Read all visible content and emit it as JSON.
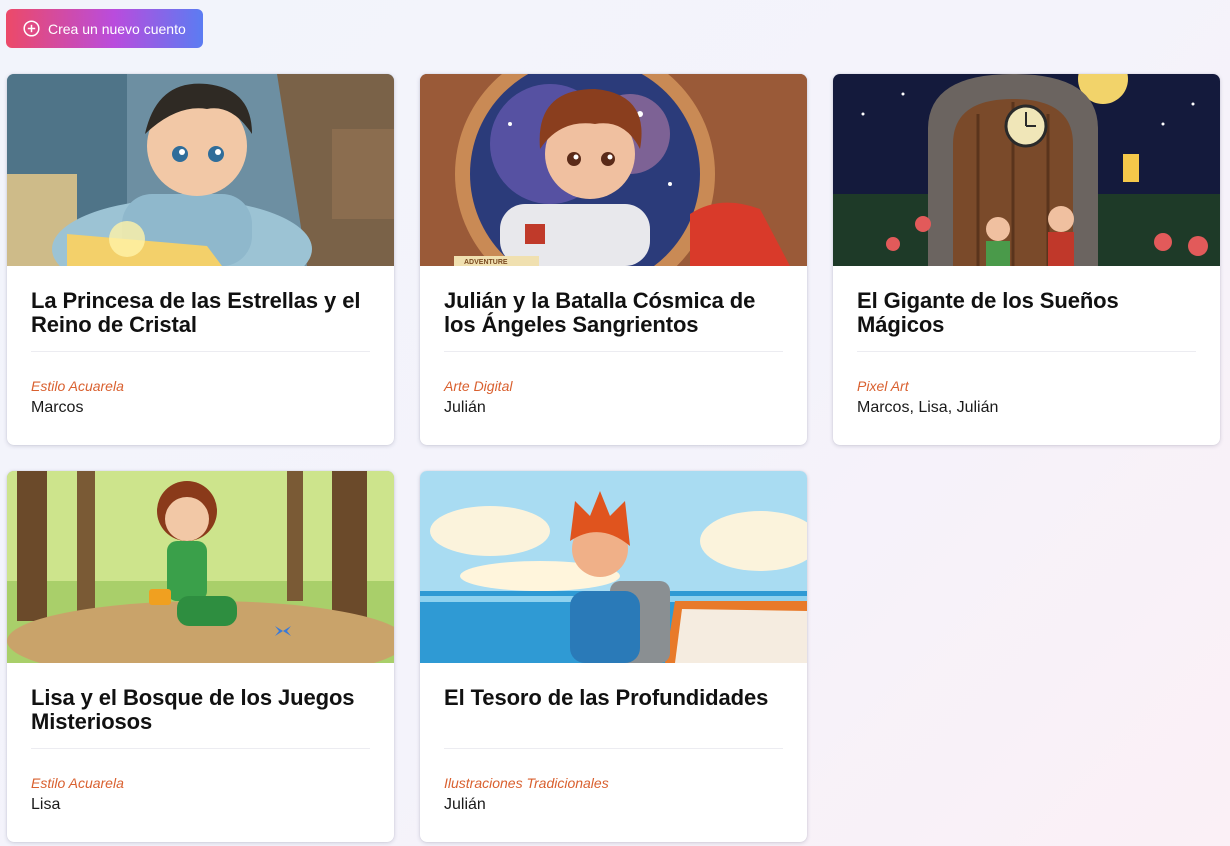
{
  "toolbar": {
    "create_label": "Crea un nuevo cuento"
  },
  "stories": [
    {
      "title": "La Princesa de las Estrellas y el Reino de Cristal",
      "style": "Estilo Acuarela",
      "characters": "Marcos"
    },
    {
      "title": "Julián y la Batalla Cósmica de los Ángeles Sangrientos",
      "style": "Arte Digital",
      "characters": "Julián"
    },
    {
      "title": "El Gigante de los Sueños Mágicos",
      "style": "Pixel Art",
      "characters": "Marcos, Lisa, Julián"
    },
    {
      "title": "Lisa y el Bosque de los Juegos Misteriosos",
      "style": "Estilo Acuarela",
      "characters": "Lisa"
    },
    {
      "title": "El Tesoro de las Profundidades",
      "style": "Ilustraciones Tradicionales",
      "characters": "Julián"
    }
  ],
  "images": {
    "story_0": "boy-reading-glowing-map",
    "story_1": "boy-astronaut-spaceship-window",
    "story_2": "night-wooden-door-with-clock",
    "story_3": "girl-in-forest-with-butterfly",
    "story_4": "boy-on-boat-at-sea"
  },
  "sign_1": "ADVENTURE",
  "colors": {
    "accent_start": "#ec4a68",
    "accent_mid": "#b94cdd",
    "accent_end": "#5b7cf2",
    "style_label": "#d9602f"
  }
}
